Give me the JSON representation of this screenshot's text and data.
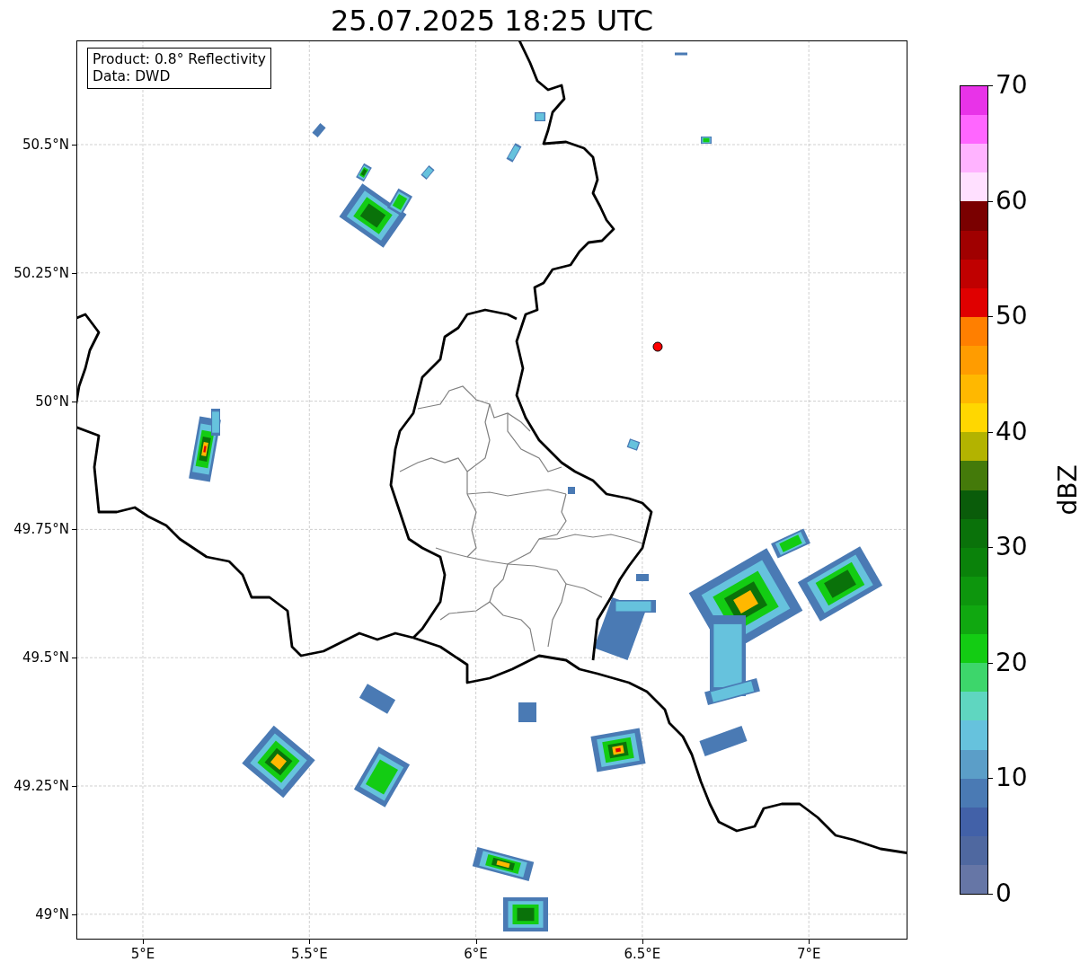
{
  "title": "25.07.2025 18:25 UTC",
  "info_box": {
    "lines": [
      "Product: 0.8° Reflectivity",
      "Data: DWD"
    ]
  },
  "y_axis": {
    "ticks": [
      "50.5°N",
      "50.25°N",
      "50°N",
      "49.75°N",
      "49.5°N",
      "49.25°N",
      "49°N"
    ]
  },
  "x_axis": {
    "ticks": [
      "5°E",
      "5.5°E",
      "6°E",
      "6.5°E",
      "7°E"
    ]
  },
  "colorbar": {
    "label": "dBZ",
    "ticks": [
      "70",
      "60",
      "50",
      "40",
      "30",
      "20",
      "10",
      "0"
    ],
    "segments": [
      {
        "color": "#e833e8"
      },
      {
        "color": "#ff66ff"
      },
      {
        "color": "#ffb3ff"
      },
      {
        "color": "#ffe0ff"
      },
      {
        "color": "#7a0000"
      },
      {
        "color": "#a00000"
      },
      {
        "color": "#c00000"
      },
      {
        "color": "#e00000"
      },
      {
        "color": "#ff7f00"
      },
      {
        "color": "#ff9c00"
      },
      {
        "color": "#ffb800"
      },
      {
        "color": "#ffd700"
      },
      {
        "color": "#b3b300"
      },
      {
        "color": "#447a0a"
      },
      {
        "color": "#0a5c0a"
      },
      {
        "color": "#0a720a"
      },
      {
        "color": "#0a820a"
      },
      {
        "color": "#0d960d"
      },
      {
        "color": "#10a810"
      },
      {
        "color": "#13cc13"
      },
      {
        "color": "#3dd66b"
      },
      {
        "color": "#5fd6c0"
      },
      {
        "color": "#66c2dd"
      },
      {
        "color": "#5b9ec8"
      },
      {
        "color": "#4a7ab4"
      },
      {
        "color": "#4261a8"
      },
      {
        "color": "#4f68a0"
      },
      {
        "color": "#6676a6"
      }
    ]
  }
}
